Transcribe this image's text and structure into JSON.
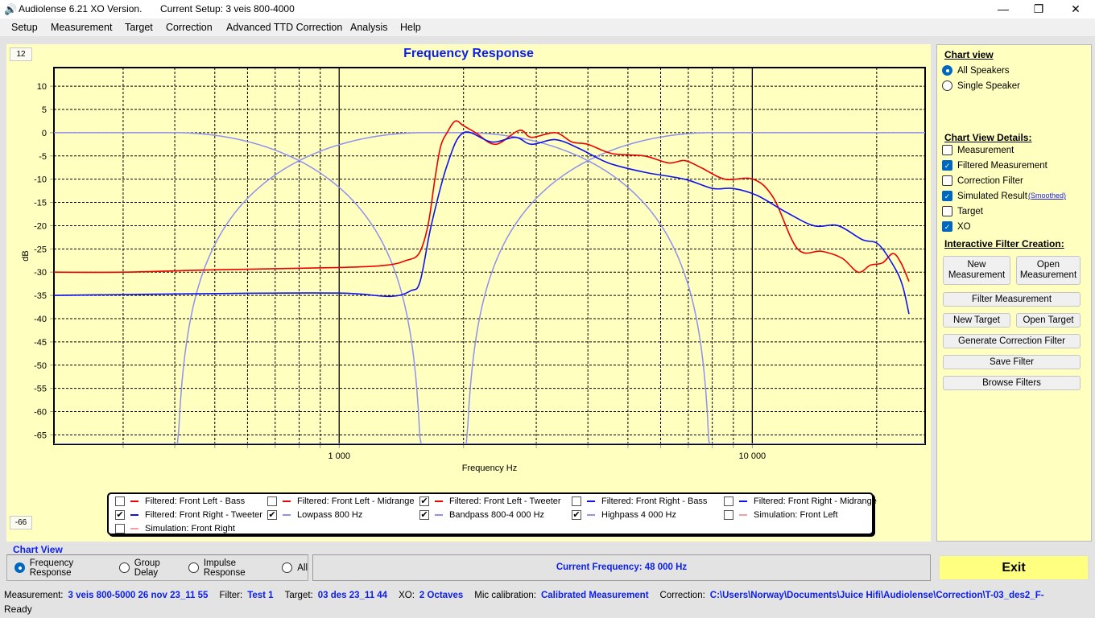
{
  "title_bar": {
    "app_title": "Audiolense 6.21 XO Version.",
    "setup": "Current Setup: 3 veis 800-4000",
    "minimize": "—",
    "maximize": "❐",
    "close": "✕"
  },
  "menu": [
    "Setup",
    "Measurement",
    "Target",
    "Correction",
    "Advanced TTD Correction",
    "Analysis",
    "Help"
  ],
  "chart_range": {
    "top": "12",
    "bottom": "-66"
  },
  "chart_data": {
    "type": "line",
    "title": "Frequency Response",
    "xlabel": "Frequency Hz",
    "ylabel": "dB",
    "xscale": "log",
    "xlim": [
      204,
      26200
    ],
    "ylim": [
      -67,
      14
    ],
    "xticks": [
      {
        "v": 1000,
        "label": "1 000"
      },
      {
        "v": 10000,
        "label": "10 000"
      }
    ],
    "yticks": [
      10,
      5,
      0,
      -5,
      -10,
      -15,
      -20,
      -25,
      -30,
      -35,
      -40,
      -45,
      -50,
      -55,
      -60,
      -65
    ],
    "grid": true,
    "colors": {
      "red": "#ee0000",
      "blue": "#1010ee",
      "xo": "#9090f0"
    },
    "series": [
      {
        "name": "Filtered: Front Left - Tweeter",
        "color": "#ee0000",
        "points": [
          [
            204,
            -30
          ],
          [
            300,
            -30
          ],
          [
            500,
            -29.5
          ],
          [
            1000,
            -29
          ],
          [
            1300,
            -28.5
          ],
          [
            1450,
            -27.5
          ],
          [
            1560,
            -26
          ],
          [
            1640,
            -20
          ],
          [
            1705,
            -10
          ],
          [
            1760,
            -3
          ],
          [
            1825,
            0
          ],
          [
            1910,
            2.5
          ],
          [
            2000,
            1.5
          ],
          [
            2140,
            0
          ],
          [
            2390,
            -2.5
          ],
          [
            2730,
            0.5
          ],
          [
            2920,
            -1
          ],
          [
            3340,
            0
          ],
          [
            3660,
            -2
          ],
          [
            4000,
            -2.5
          ],
          [
            4580,
            -4.5
          ],
          [
            5480,
            -5
          ],
          [
            6270,
            -6.5
          ],
          [
            6860,
            -6
          ],
          [
            7510,
            -7.5
          ],
          [
            8590,
            -10
          ],
          [
            10050,
            -10
          ],
          [
            11250,
            -14
          ],
          [
            12870,
            -25
          ],
          [
            14730,
            -25.5
          ],
          [
            16500,
            -27
          ],
          [
            18040,
            -30
          ],
          [
            19310,
            -28.5
          ],
          [
            20660,
            -28
          ],
          [
            21900,
            -26
          ],
          [
            22900,
            -28
          ],
          [
            23950,
            -32
          ]
        ]
      },
      {
        "name": "Filtered: Front Right - Tweeter",
        "color": "#1010ee",
        "points": [
          [
            204,
            -35
          ],
          [
            500,
            -34.6
          ],
          [
            1000,
            -34.5
          ],
          [
            1330,
            -35.2
          ],
          [
            1490,
            -34
          ],
          [
            1570,
            -32
          ],
          [
            1670,
            -20
          ],
          [
            1825,
            -7
          ],
          [
            2000,
            0
          ],
          [
            2340,
            -2
          ],
          [
            2670,
            -1
          ],
          [
            2920,
            -2.5
          ],
          [
            3340,
            -1.5
          ],
          [
            3830,
            -3.5
          ],
          [
            4480,
            -6.5
          ],
          [
            5480,
            -8.5
          ],
          [
            6860,
            -10
          ],
          [
            8020,
            -12
          ],
          [
            8980,
            -12
          ],
          [
            10270,
            -13.5
          ],
          [
            12020,
            -17
          ],
          [
            14080,
            -20
          ],
          [
            16120,
            -20
          ],
          [
            18450,
            -23
          ],
          [
            20200,
            -24
          ],
          [
            22100,
            -29
          ],
          [
            23120,
            -33
          ],
          [
            23950,
            -39
          ]
        ]
      }
    ],
    "xo_filters": [
      {
        "name": "Lowpass 800 Hz",
        "type": "lowpass",
        "fc": 800,
        "width_octaves": 2
      },
      {
        "name": "Bandpass 800-4 000 Hz",
        "type": "bandpass",
        "f1": 800,
        "f2": 4000,
        "width_octaves": 2
      },
      {
        "name": "Highpass 4 000 Hz",
        "type": "highpass",
        "fc": 4000,
        "width_octaves": 2
      }
    ]
  },
  "legend": [
    {
      "label": "Filtered: Front Left - Bass",
      "checked": false,
      "color": "#ee0000"
    },
    {
      "label": "Filtered: Front Left - Midrange",
      "checked": false,
      "color": "#ee0000"
    },
    {
      "label": "Filtered: Front Left - Tweeter",
      "checked": true,
      "color": "#ee0000"
    },
    {
      "label": "Filtered: Front Right - Bass",
      "checked": false,
      "color": "#1010ee"
    },
    {
      "label": "Filtered: Front Right - Midrange",
      "checked": false,
      "color": "#1010ee"
    },
    {
      "label": "Filtered: Front Right - Tweeter",
      "checked": true,
      "color": "#1010ee"
    },
    {
      "label": "Lowpass  800 Hz",
      "checked": true,
      "color": "#9090f0"
    },
    {
      "label": "Bandpass   800-4 000 Hz",
      "checked": true,
      "color": "#9090f0"
    },
    {
      "label": "Highpass  4 000 Hz",
      "checked": true,
      "color": "#9090f0"
    },
    {
      "label": "Simulation: Front Left",
      "checked": false,
      "color": "#f4a0a0"
    },
    {
      "label": "Simulation: Front Right",
      "checked": false,
      "color": "#f4a0a0"
    }
  ],
  "right_panel": {
    "chart_view_title": "Chart view",
    "all_speakers": "All Speakers",
    "single_speaker": "Single Speaker",
    "details_title": "Chart View Details:",
    "details": [
      {
        "label": "Measurement",
        "checked": false
      },
      {
        "label": "Filtered Measurement",
        "checked": true
      },
      {
        "label": "Correction Filter",
        "checked": false
      },
      {
        "label": "Simulated Result",
        "checked": true
      },
      {
        "label": "Target",
        "checked": false
      },
      {
        "label": "XO",
        "checked": true
      }
    ],
    "smoothed_link": "(Smoothed)",
    "interactive_title": "Interactive Filter Creation:",
    "buttons": {
      "new_measurement": "New Measurement",
      "open_measurement": "Open Measurement",
      "filter_measurement": "Filter Measurement",
      "new_target": "New Target",
      "open_target": "Open Target",
      "generate": "Generate Correction Filter",
      "save": "Save Filter",
      "browse": "Browse Filters"
    }
  },
  "bottom": {
    "chart_view_label": "Chart View",
    "views": [
      "Frequency Response",
      "Group Delay",
      "Impulse Response",
      "All"
    ],
    "current_frequency": "Current Frequency: 48 000 Hz",
    "exit": "Exit"
  },
  "status": {
    "measurement_label": "Measurement:",
    "measurement": "3 veis 800-5000 26 nov 23_11 55",
    "filter_label": "Filter:",
    "filter": "Test 1",
    "target_label": "Target:",
    "target": "03 des 23_11 44",
    "xo_label": "XO:",
    "xo": "2 Octaves",
    "mic_label": "Mic calibration:",
    "mic": "Calibrated Measurement",
    "correction_label": "Correction:",
    "correction": "C:\\Users\\Norway\\Documents\\Juice Hifi\\Audiolense\\Correction\\T-03_des2_F-",
    "ready": "Ready"
  }
}
